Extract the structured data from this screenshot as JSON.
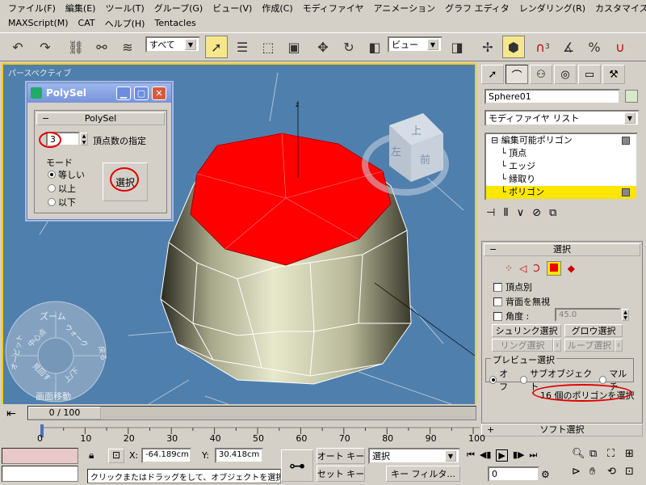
{
  "menu": {
    "row1": [
      "ファイル(F)",
      "編集(E)",
      "ツール(T)",
      "グループ(G)",
      "ビュー(V)",
      "作成(C)",
      "モディファイヤ",
      "アニメーション",
      "グラフ エディタ",
      "レンダリング(R)",
      "カスタマイズ(U)"
    ],
    "row2": [
      "MAXScript(M)",
      "CAT",
      "ヘルプ(H)",
      "Tentacles"
    ]
  },
  "toolbar": {
    "filter_value": "すべて",
    "refcoord_value": "ビュー",
    "angle_snap": "3",
    "pct_snap": "%"
  },
  "viewport": {
    "label": "パースペクティブ",
    "viewcube_top": "上",
    "viewcube_left": "左",
    "viewcube_front": "前",
    "wheel_zoom": "ズーム",
    "wheel_orbit": "オービット",
    "wheel_center": "中心点",
    "wheel_walk": "ウォーク",
    "wheel_rewind": "戻る",
    "wheel_look": "見回す",
    "wheel_updown": "上/下",
    "wheel_pan": "画面移動",
    "axis_z": "z"
  },
  "dialog": {
    "title": "PolySel",
    "group_title": "PolySel",
    "vertex_count": "3",
    "vertex_label": "頂点数の指定",
    "mode_label": "モード",
    "mode_options": [
      "等しい",
      "以上",
      "以下"
    ],
    "select_button": "選択"
  },
  "panel": {
    "object_name": "Sphere01",
    "modifier_list": "モディファイヤ リスト",
    "stack": [
      "編集可能ポリゴン",
      "頂点",
      "エッジ",
      "縁取り",
      "ポリゴン"
    ],
    "select_rollout": "選択",
    "by_vertex": "頂点別",
    "ignore_backfacing": "背面を無視",
    "angle_label": "角度 :",
    "angle_value": "45.0",
    "shrink": "シュリンク選択",
    "grow": "グロウ選択",
    "ring": "リング選択",
    "loop": "ループ選択",
    "preview_label": "プレビュー選択",
    "preview_options": [
      "オフ",
      "サブオブジェクト",
      "マルチ"
    ],
    "status": "16 個のポリゴンを選択",
    "soft_selection": "ソフト選択"
  },
  "timeline": {
    "frame": "0 / 100",
    "ticks": [
      "0",
      "10",
      "20",
      "30",
      "40",
      "50",
      "60",
      "70",
      "80",
      "90",
      "100"
    ]
  },
  "statusbar": {
    "x_label": "X:",
    "x_value": "-64.189cm",
    "y_label": "Y:",
    "y_value": "30.418cm",
    "auto_key": "オート キー",
    "set_key": "セット キー",
    "key_mode": "選択",
    "key_filter": "キー フィルタ...",
    "frame_value": "0",
    "prompt": "クリックまたはドラッグをして、オブジェクトを選択しま:"
  },
  "colors": {
    "viewport_bg": "#4f7fad",
    "selected_poly": "#ff0000",
    "highlight": "#ffe600"
  }
}
